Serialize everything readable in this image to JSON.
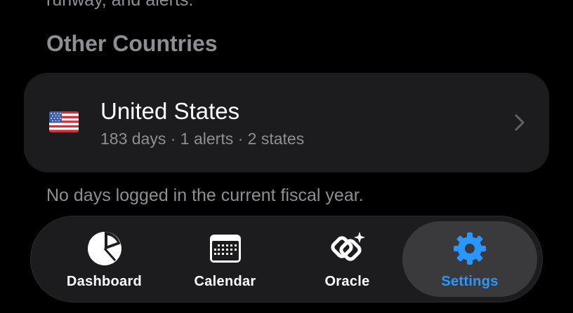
{
  "top_cut_text": "runway, and alerts.",
  "section": {
    "title": "Other Countries"
  },
  "country_card": {
    "flag_icon": "us-flag-icon",
    "name": "United States",
    "meta": "183 days · 1 alerts · 2 states"
  },
  "note": "No days logged in the current fiscal year.",
  "tabbar": {
    "active_color": "#2997ff",
    "tabs": [
      {
        "label": "Dashboard",
        "icon": "pie-chart-icon"
      },
      {
        "label": "Calendar",
        "icon": "calendar-icon"
      },
      {
        "label": "Oracle",
        "icon": "oracle-sparkle-icon"
      },
      {
        "label": "Settings",
        "icon": "gear-icon",
        "active": true
      }
    ]
  }
}
